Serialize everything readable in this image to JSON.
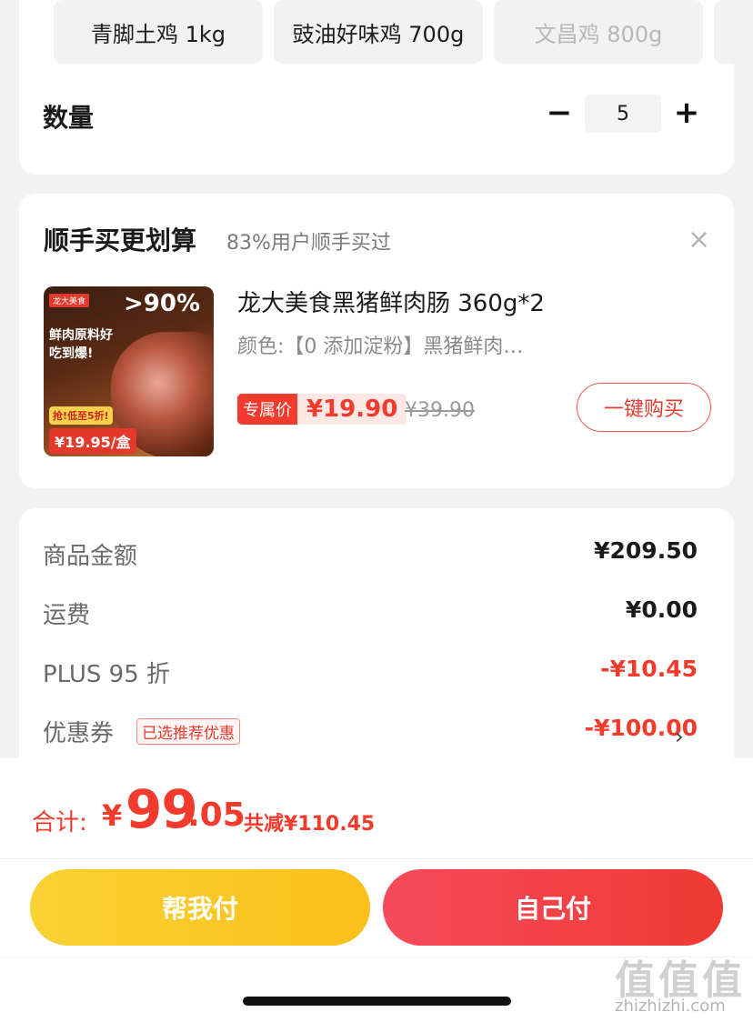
{
  "variants": {
    "items": [
      {
        "label": "青脚土鸡 1kg",
        "disabled": false
      },
      {
        "label": "豉油好味鸡 700g",
        "disabled": false
      },
      {
        "label": "文昌鸡 800g",
        "disabled": true
      },
      {
        "label": "",
        "disabled": false
      }
    ]
  },
  "quantity": {
    "label": "数量",
    "minus": "−",
    "value": "5",
    "plus": "+"
  },
  "addon": {
    "title": "顺手买更划算",
    "subtitle": "83%用户顺手买过",
    "close": "×",
    "image": {
      "brand": "龙大美食",
      "pct": ">90%",
      "slogan": "鲜肉原料好吃到爆!",
      "tag": "抢!低至5折!",
      "mini_price": "¥19.95/盒"
    },
    "product_name": "龙大美食黑猪鲜肉肠 360g*2",
    "spec": "颜色:【0 添加淀粉】黑猪鲜肉…",
    "price_tag": "专属价",
    "price": "¥19.90",
    "original_price": "¥39.90",
    "buy_button": "一键购买"
  },
  "summary": {
    "goods_label": "商品金额",
    "goods_value": "¥209.50",
    "shipping_label": "运费",
    "shipping_value": "¥0.00",
    "plus_label": "PLUS 95 折",
    "plus_value": "-¥10.45",
    "coupon_label": "优惠券",
    "coupon_badge": "已选推荐优惠",
    "coupon_value": "-¥100.00",
    "coupon_chevron": "›"
  },
  "checkout": {
    "total_label": "合计:",
    "total_yen": "¥",
    "total_int": "99",
    "total_dec": ".05",
    "saved": "共减¥110.45",
    "help_pay": "帮我付",
    "self_pay": "自己付"
  },
  "watermark": {
    "logo": "值值值",
    "url": "zhizhizhi.com"
  },
  "colors": {
    "accent_red": "#f23b2d",
    "yellow_button": "#fbbf1b",
    "red_button": "#ef3a33"
  }
}
